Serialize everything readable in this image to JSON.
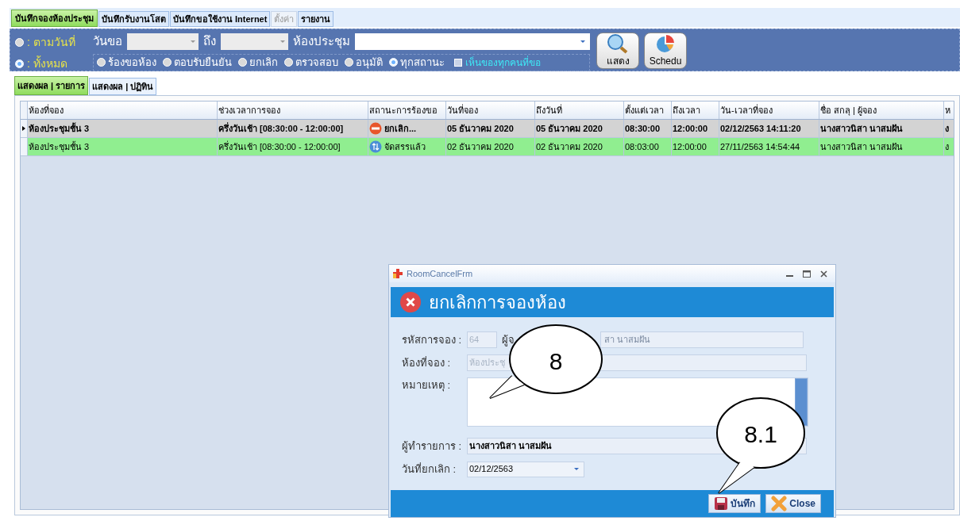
{
  "main_tabs": [
    {
      "label": "บันทึกจองห้องประชุม",
      "selected": true,
      "disabled": false
    },
    {
      "label": "บันทึกรับงานโสต",
      "selected": false,
      "disabled": false
    },
    {
      "label": "บันทึกขอใช้งาน Internet",
      "selected": false,
      "disabled": false
    },
    {
      "label": "ตั้งค่า",
      "selected": false,
      "disabled": true
    },
    {
      "label": "รายงาน",
      "selected": false,
      "disabled": false
    }
  ],
  "filter": {
    "mode_options": [
      {
        "label": ": ตามวันที่",
        "selected": false
      },
      {
        "label": ": ทั้งหมด",
        "selected": true
      }
    ],
    "date_from_label": "วันขอ",
    "date_to_label": "ถึง",
    "room_label": "ห้องประชุม",
    "status_options": [
      {
        "label": "ร้องขอห้อง",
        "selected": false
      },
      {
        "label": "ตอบรับยืนยัน",
        "selected": false
      },
      {
        "label": "ยกเลิก",
        "selected": false
      },
      {
        "label": "ตรวจสอบ",
        "selected": false
      },
      {
        "label": "อนุมัติ",
        "selected": false
      },
      {
        "label": "ทุกสถานะ",
        "selected": true
      }
    ],
    "see_all": {
      "label": "เห็นของทุกคนที่ขอ",
      "checked": false
    },
    "buttons": [
      {
        "label": "แสดง",
        "kind": "search"
      },
      {
        "label": "Schedu",
        "kind": "chart"
      }
    ]
  },
  "view_tabs": [
    {
      "label": "แสดงผล | รายการ",
      "selected": true
    },
    {
      "label": "แสดงผล | ปฏิทิน",
      "selected": false
    }
  ],
  "table": {
    "columns": [
      "ห้องที่จอง",
      "ช่วงเวลาการจอง",
      "สถานะการร้องขอ",
      "วันที่จอง",
      "ถึงวันที่",
      "ตั้งแต่เวลา",
      "ถึงเวลา",
      "วัน-เวลาที่จอง",
      "ชื่อ สกลุ | ผู้จอง",
      "ห"
    ],
    "rows": [
      {
        "selected": true,
        "kind": "cancel",
        "cells": [
          "ห้องประชุมชั้น 3",
          "ครึ่งวันเช้า [08:30:00 - 12:00:00]",
          "ยกเลิก...",
          "05 ธันวาคม 2020",
          "05 ธันวาคม 2020",
          "08:30:00",
          "12:00:00",
          "02/12/2563 14:11:20",
          "นางสาวนิสา  นาสมฝัน",
          "ง"
        ]
      },
      {
        "selected": false,
        "kind": "allocated",
        "cells": [
          "ห้องประชุมชั้น 3",
          "ครึ่งวันเช้า [08:30:00 - 12:00:00]",
          "จัดสรรแล้ว",
          "02 ธันวาคม 2020",
          "02 ธันวาคม 2020",
          "08:03:00",
          "12:00:00",
          "27/11/2563 14:54:44",
          "นางสาวนิสา  นาสมฝัน",
          "ง"
        ]
      }
    ]
  },
  "dialog": {
    "title": "RoomCancelFrm",
    "heading": "ยกเลิกการจองห้อง",
    "booking_code_label": "รหัสการจอง :",
    "booking_code": "64",
    "booker_label": "ผู้จ",
    "booker_value": "สา  นาสมฝัน",
    "room_label": "ห้องที่จอง :",
    "room_value": "ห้องประชุ",
    "note_label": "หมายเหตุ :",
    "operator_label": "ผู้ทำรายการ :",
    "operator_value": "นางสาวนิสา  นาสมฝัน",
    "cancel_date_label": "วันที่ยกเลิก :",
    "cancel_date": "02/12/2563",
    "buttons": [
      {
        "label": "บันทึก",
        "kind": "save"
      },
      {
        "label": "Close",
        "kind": "close"
      }
    ]
  },
  "callouts": [
    {
      "label": "8"
    },
    {
      "label": "8.1"
    }
  ]
}
